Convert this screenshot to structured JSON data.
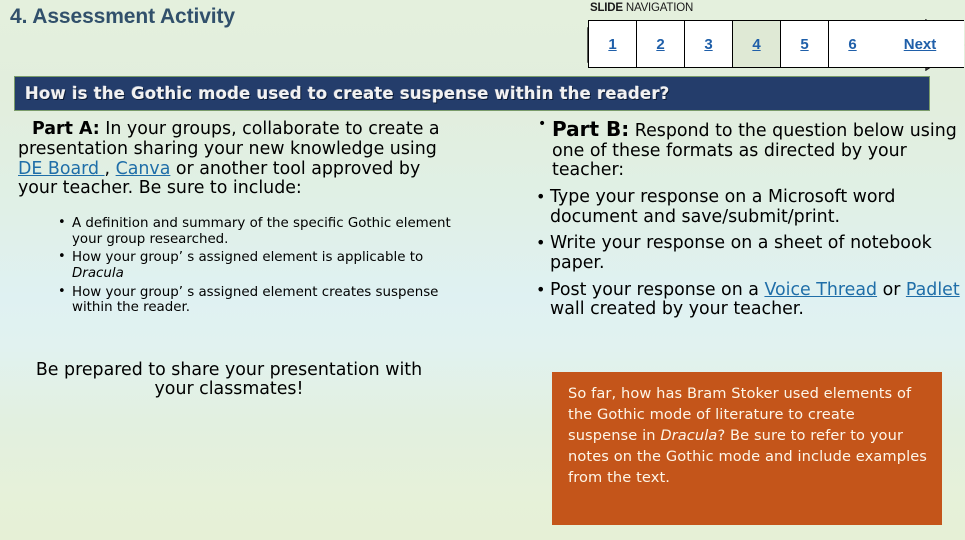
{
  "slide": {
    "title": "4. Assessment Activity",
    "question_banner": "How is the Gothic mode used to create suspense within the reader?"
  },
  "navigation": {
    "label_bold": "SLIDE",
    "label_light": " NAVIGATION",
    "active_slide": "4",
    "slides": [
      "1",
      "2",
      "3",
      "4",
      "5",
      "6"
    ],
    "next_label": "Next"
  },
  "part_a": {
    "label": "Part A:",
    "intro_1": " In your groups, collaborate to create a presentation sharing your new knowledge using ",
    "link_de_board": "DE Board ",
    "intro_2": ", ",
    "link_canva": "Canva",
    "intro_3": " or another tool approved by your teacher. Be sure to include:",
    "bullets": [
      {
        "text_1": "A definition and summary of the specific Gothic element your group researched.",
        "italic": "",
        "text_2": ""
      },
      {
        "text_1": "How your group’  s assigned element is applicable to ",
        "italic": "Dracula",
        "text_2": ""
      },
      {
        "text_1": "How your group’  s assigned element creates suspense within the reader.",
        "italic": "",
        "text_2": ""
      }
    ],
    "closing": "Be prepared to share your presentation with your classmates!"
  },
  "part_b": {
    "label": "Part B:",
    "intro": " Respond to the question below using one of these formats as directed by your teacher:",
    "bullet_2": "Type your response on a Microsoft word document and save/submit/print.",
    "bullet_3": "Write your response on a sheet of notebook paper.",
    "bullet_4_pre": "Post your response on a ",
    "bullet_4_link_1": "Voice Thread",
    "bullet_4_mid": " or ",
    "bullet_4_link_2": "Padlet",
    "bullet_4_post": " wall created by your teacher."
  },
  "callout": {
    "text_1": "So far, how has Bram Stoker used elements of the Gothic mode of literature to create suspense in ",
    "italic": "Dracula",
    "text_2": "? Be sure to refer to your notes on the Gothic mode and include examples from the text."
  },
  "colors": {
    "title": "#31506b",
    "banner_bg": "#243d6b",
    "callout_bg": "#c4551a",
    "link": "#1f6ea8",
    "nav_link": "#1f5fa9",
    "active_cell": "#dfe9d5"
  }
}
